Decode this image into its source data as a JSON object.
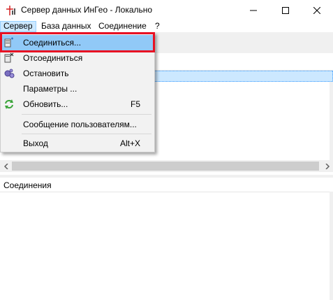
{
  "window": {
    "title": "Сервер данных ИнГео - Локально",
    "minimize_icon": "minimize-icon",
    "maximize_icon": "maximize-icon",
    "close_icon": "close-icon"
  },
  "menubar": {
    "items": [
      {
        "label": "Сервер"
      },
      {
        "label": "База данных"
      },
      {
        "label": "Соединение"
      },
      {
        "label": "?"
      }
    ]
  },
  "server_menu": {
    "items": [
      {
        "label": "Соединиться...",
        "shortcut": "",
        "icon": "connect-icon"
      },
      {
        "label": "Отсоединиться",
        "shortcut": "",
        "icon": "disconnect-icon"
      },
      {
        "label": "Остановить",
        "shortcut": "",
        "icon": "stop-icon"
      },
      {
        "label": "Параметры ...",
        "shortcut": "",
        "icon": ""
      },
      {
        "label": "Обновить...",
        "shortcut": "F5",
        "icon": "refresh-icon"
      },
      {
        "label": "Сообщение пользователям...",
        "shortcut": "",
        "icon": ""
      },
      {
        "label": "Выход",
        "shortcut": "Alt+X",
        "icon": ""
      }
    ]
  },
  "lower_panel": {
    "header": "Соединения"
  },
  "colors": {
    "highlight": "#91c9f7",
    "annotation_red": "#e81123",
    "selection": "#cce8ff"
  }
}
